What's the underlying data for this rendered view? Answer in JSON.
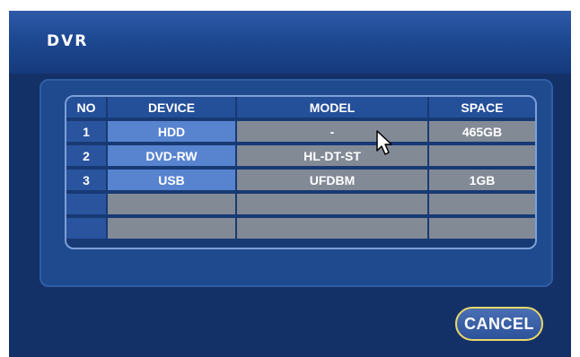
{
  "window": {
    "title": "DVR"
  },
  "table": {
    "headers": {
      "no": "NO",
      "device": "DEVICE",
      "model": "MODEL",
      "space": "SPACE"
    },
    "rows": [
      {
        "no": "1",
        "device": "HDD",
        "model": "-",
        "space": "465GB"
      },
      {
        "no": "2",
        "device": "DVD-RW",
        "model": "HL-DT-ST",
        "space": ""
      },
      {
        "no": "3",
        "device": "USB",
        "model": "UFDBM",
        "space": "1GB"
      },
      {
        "no": "",
        "device": "",
        "model": "",
        "space": ""
      },
      {
        "no": "",
        "device": "",
        "model": "",
        "space": ""
      }
    ]
  },
  "buttons": {
    "cancel_label": "CANCEL"
  },
  "colors": {
    "background": "#143167",
    "header_cell": "#244f99",
    "device_cell": "#5783cf",
    "data_cell": "#828a96",
    "button_border": "#e8d86a"
  }
}
